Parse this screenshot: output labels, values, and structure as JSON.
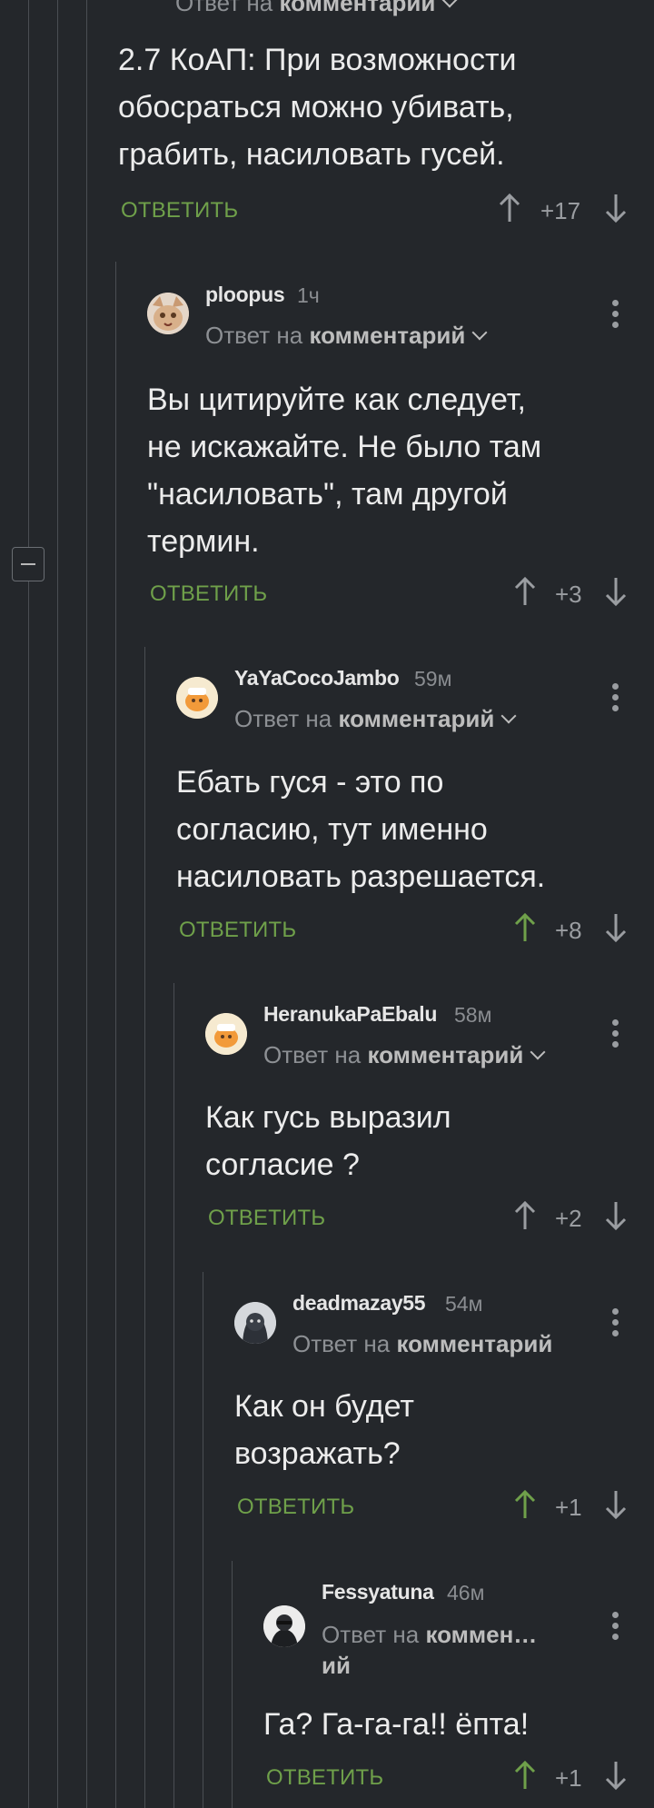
{
  "top_partial": {
    "reply_prefix": "Ответ на",
    "reply_target": "комментарий"
  },
  "comments": [
    {
      "author": "",
      "time": "",
      "reply_prefix": "",
      "reply_target": "",
      "text_lines": [
        "2.7 КоАП: При возможности",
        "обосраться можно убивать,",
        "грабить, насиловать гусей."
      ],
      "reply_label": "ОТВЕТИТЬ",
      "score": "+17",
      "upvoted": false
    },
    {
      "author": "ploopus",
      "time": "1ч",
      "reply_prefix": "Ответ на",
      "reply_target": "комментарий",
      "text_lines": [
        "Вы цитируйте как следует,",
        "не искажайте. Не было там",
        "\"насиловать\", там другой",
        "термин."
      ],
      "reply_label": "ОТВЕТИТЬ",
      "score": "+3",
      "upvoted": false
    },
    {
      "author": "YaYaCocoJambo",
      "time": "59м",
      "reply_prefix": "Ответ на",
      "reply_target": "комментарий",
      "text_lines": [
        "Ебать гуся - это по",
        "согласию, тут именно",
        "насиловать разрешается."
      ],
      "reply_label": "ОТВЕТИТЬ",
      "score": "+8",
      "upvoted": true
    },
    {
      "author": "HeranukaPaEbalu",
      "time": "58м",
      "reply_prefix": "Ответ на",
      "reply_target": "комментарий",
      "text_lines": [
        "Как гусь выразил",
        "согласие ?"
      ],
      "reply_label": "ОТВЕТИТЬ",
      "score": "+2",
      "upvoted": false
    },
    {
      "author": "deadmazay55",
      "time": "54м",
      "reply_prefix": "Ответ на",
      "reply_target": "комментарий",
      "text_lines": [
        "Как он будет",
        "возражать?"
      ],
      "reply_label": "ОТВЕТИТЬ",
      "score": "+1",
      "upvoted": true
    },
    {
      "author": "Fessyatuna",
      "time": "46м",
      "reply_prefix": "Ответ на",
      "reply_target": "коммен…",
      "reply_target_wrap": "ий",
      "text_lines": [
        "Га? Га-га-га!! ёпта!"
      ],
      "reply_label": "ОТВЕТИТЬ",
      "score": "+1",
      "upvoted": true
    }
  ],
  "colors": {
    "background": "#24272b",
    "accent_green": "#6fa04a",
    "muted": "#8d9094"
  },
  "icons": [
    "collapse-minus-icon",
    "more-vertical-icon",
    "upvote-arrow-icon",
    "downvote-arrow-icon",
    "chevron-down-icon"
  ]
}
